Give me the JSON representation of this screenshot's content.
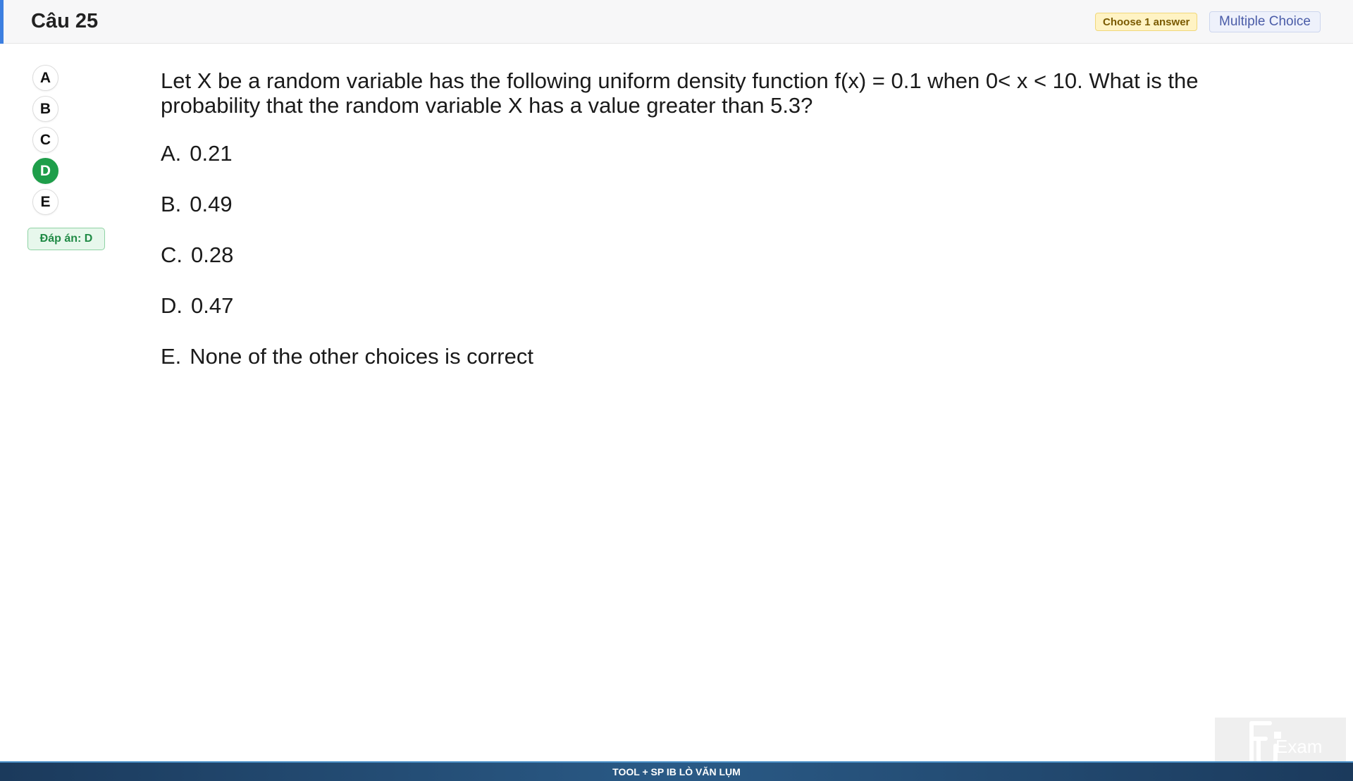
{
  "header": {
    "title": "Câu 25",
    "badge_choose": "Choose 1 answer",
    "badge_type": "Multiple Choice",
    "accent_color": "#3d7fe0"
  },
  "options": [
    {
      "label": "A",
      "selected": false
    },
    {
      "label": "B",
      "selected": false
    },
    {
      "label": "C",
      "selected": false
    },
    {
      "label": "D",
      "selected": true
    },
    {
      "label": "E",
      "selected": false
    }
  ],
  "answer": {
    "text": "Đáp án: D",
    "color": "#1f8a45"
  },
  "question": {
    "text": "Let X be a random variable has the following uniform density function f(x) = 0.1 when 0< x < 10. What is the probability that the random variable X has a value greater than 5.3?",
    "choices": [
      {
        "letter": "A.",
        "text": "0.21"
      },
      {
        "letter": "B.",
        "text": "0.49"
      },
      {
        "letter": "C.",
        "text": "0.28"
      },
      {
        "letter": "D.",
        "text": "0.47"
      },
      {
        "letter": "E.",
        "text": "None of the other choices is correct"
      }
    ]
  },
  "footer": {
    "text": "TOOL + SP IB LÒ VĂN LỤM"
  },
  "logo": {
    "name": "fu-exam-logo",
    "text": "Exam"
  },
  "colors": {
    "selected_option": "#1e9e4a",
    "footer_bg": "#1b3a5c"
  }
}
